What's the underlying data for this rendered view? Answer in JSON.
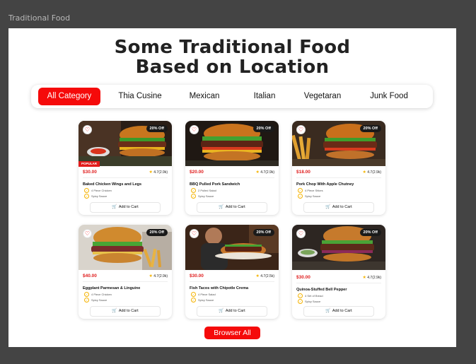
{
  "window": {
    "title": "Traditional Food"
  },
  "headline": {
    "line1": "Some Traditional Food",
    "line2": "Based on Location"
  },
  "tabs": [
    "All Category",
    "Thia Cusine",
    "Mexican",
    "Italian",
    "Vegetaran",
    "Junk Food"
  ],
  "active_tab": "All Category",
  "cards": [
    {
      "price": "$30.00",
      "rating": "4.7(2.9k)",
      "name": "Baked Chicken Wings and Legs",
      "badge": "20% Off",
      "tag": "POPULAR",
      "features": [
        "4 Piece Chicken",
        "Spicy Sauce"
      ],
      "cart": "Add to Cart"
    },
    {
      "price": "$20.00",
      "rating": "4.7(2.9k)",
      "name": "BBQ Pulled Pork Sandwich",
      "badge": "20% Off",
      "tag": "",
      "features": [
        "2 Pulled Salad",
        "Spicy Sauce"
      ],
      "cart": "Add to Cart"
    },
    {
      "price": "$18.00",
      "rating": "4.7(2.9k)",
      "name": "Pork Chop With Apple Chutney",
      "badge": "20% Off",
      "tag": "",
      "features": [
        "4 Piece Shkes",
        "Spicy Sauce"
      ],
      "cart": "Add to Cart"
    },
    {
      "price": "$40.00",
      "rating": "4.7(2.9k)",
      "name": "Eggplant Parmesan & Linguine",
      "badge": "20% Off",
      "tag": "",
      "features": [
        "4 Piece Chicken",
        "Spicy Sauce"
      ],
      "cart": "Add to Cart"
    },
    {
      "price": "$30.00",
      "rating": "4.7(2.5k)",
      "name": "Fish Tacos with Chipotle Crema",
      "badge": "20% Off",
      "tag": "",
      "features": [
        "4 Piece Salad",
        "Spicy Sauce"
      ],
      "cart": "Add to Cart"
    },
    {
      "price": "$30.00",
      "rating": "4.7(2.9k)",
      "name": "Quinoa-Stuffed Bell Pepper",
      "badge": "20% Off",
      "tag": "",
      "features": [
        "4 Set of Bread",
        "Spicy Sauce"
      ],
      "cart": "Add to Cart"
    }
  ],
  "browse_button": "Browser All",
  "colors": {
    "accent": "#f50a0a",
    "star": "#f5b301",
    "price": "#e02020",
    "window_bg": "#444444"
  },
  "icons": [
    "heart-icon",
    "star-icon",
    "check-icon",
    "cart-icon"
  ]
}
